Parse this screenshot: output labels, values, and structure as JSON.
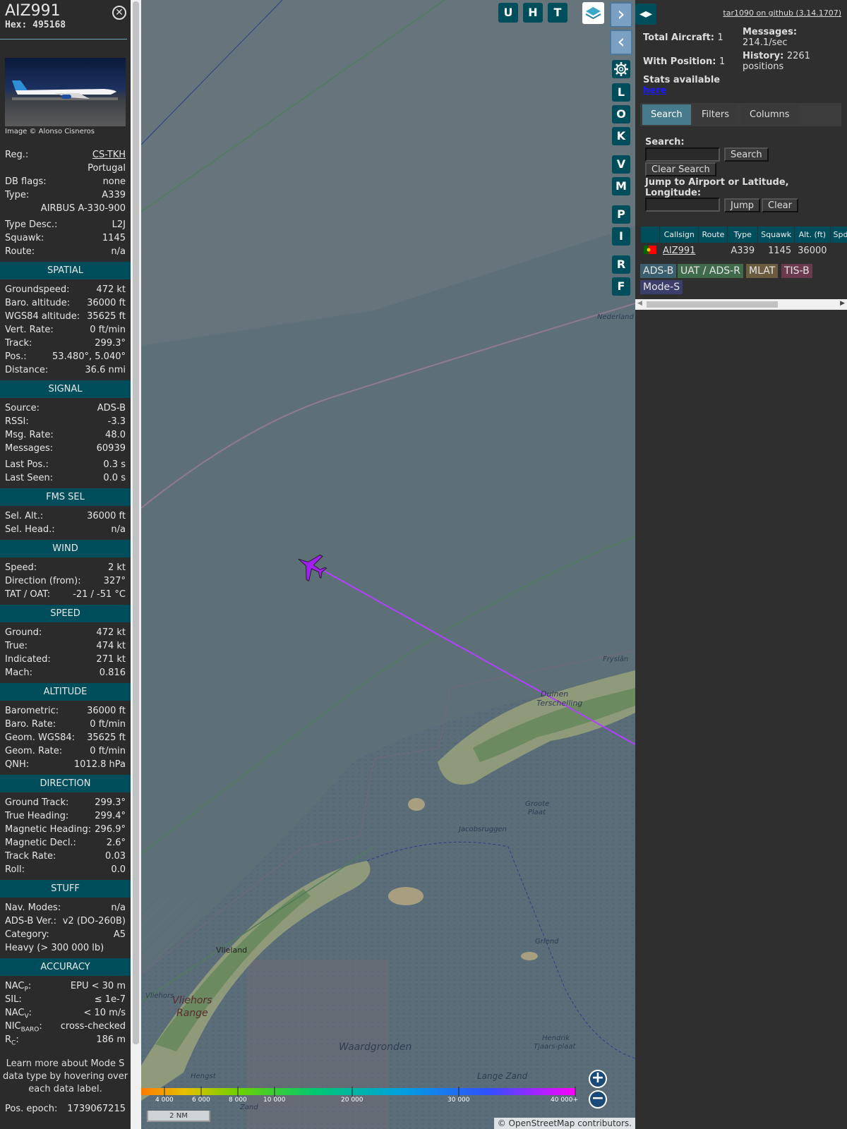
{
  "aircraft": {
    "callsign": "AIZ991",
    "hex_label": "Hex:",
    "hex": "495168",
    "photo_credit": "Image © Alonso Cisneros"
  },
  "details": [
    {
      "label": "Reg.:",
      "value": "CS-TKH",
      "link": true
    },
    {
      "label": "",
      "value": "Portugal"
    },
    {
      "label": "DB flags:",
      "value": "none"
    },
    {
      "label": "Type:",
      "value": "A339"
    },
    {
      "label": "",
      "value": "AIRBUS A-330-900"
    },
    {
      "label": "Type Desc.:",
      "value": "L2J"
    },
    {
      "label": "Squawk:",
      "value": "1145"
    },
    {
      "label": "Route:",
      "value": "n/a"
    }
  ],
  "sections": [
    {
      "title": "SPATIAL",
      "rows": [
        {
          "label": "Groundspeed:",
          "value": "472 kt"
        },
        {
          "label": "Baro. altitude:",
          "value": "36000 ft"
        },
        {
          "label": "WGS84 altitude:",
          "value": "35625 ft"
        },
        {
          "label": "Vert. Rate:",
          "value": "0 ft/min"
        },
        {
          "label": "Track:",
          "value": "299.3°"
        },
        {
          "label": "Pos.:",
          "value": "53.480°, 5.040°"
        },
        {
          "label": "Distance:",
          "value": "36.6 nmi"
        }
      ]
    },
    {
      "title": "SIGNAL",
      "rows": [
        {
          "label": "Source:",
          "value": "ADS-B"
        },
        {
          "label": "RSSI:",
          "value": "-3.3"
        },
        {
          "label": "Msg. Rate:",
          "value": "48.0"
        },
        {
          "label": "Messages:",
          "value": "60939"
        },
        {
          "label": "Last Pos.:",
          "value": "0.3 s"
        },
        {
          "label": "Last Seen:",
          "value": "0.0 s"
        }
      ]
    },
    {
      "title": "FMS SEL",
      "rows": [
        {
          "label": "Sel. Alt.:",
          "value": "36000 ft"
        },
        {
          "label": "Sel. Head.:",
          "value": "n/a"
        }
      ]
    },
    {
      "title": "WIND",
      "rows": [
        {
          "label": "Speed:",
          "value": "2 kt"
        },
        {
          "label": "Direction (from):",
          "value": "327°"
        },
        {
          "label": "TAT / OAT:",
          "value": "-21 / -51 °C"
        }
      ]
    },
    {
      "title": "SPEED",
      "rows": [
        {
          "label": "Ground:",
          "value": "472 kt"
        },
        {
          "label": "True:",
          "value": "474 kt"
        },
        {
          "label": "Indicated:",
          "value": "271 kt"
        },
        {
          "label": "Mach:",
          "value": "0.816"
        }
      ]
    },
    {
      "title": "ALTITUDE",
      "rows": [
        {
          "label": "Barometric:",
          "value": "36000 ft"
        },
        {
          "label": "Baro. Rate:",
          "value": "0 ft/min"
        },
        {
          "label": "Geom. WGS84:",
          "value": "35625 ft"
        },
        {
          "label": "Geom. Rate:",
          "value": "0 ft/min"
        },
        {
          "label": "QNH:",
          "value": "1012.8 hPa"
        }
      ]
    },
    {
      "title": "DIRECTION",
      "rows": [
        {
          "label": "Ground Track:",
          "value": "299.3°"
        },
        {
          "label": "True Heading:",
          "value": "299.4°"
        },
        {
          "label": "Magnetic Heading:",
          "value": "296.9°"
        },
        {
          "label": "Magnetic Decl.:",
          "value": "2.6°"
        },
        {
          "label": "Track Rate:",
          "value": "0.03"
        },
        {
          "label": "Roll:",
          "value": "0.0"
        }
      ]
    },
    {
      "title": "STUFF",
      "rows": [
        {
          "label": "Nav. Modes:",
          "value": "n/a"
        },
        {
          "label": "ADS-B Ver.:",
          "value": "v2 (DO-260B)"
        },
        {
          "label": "Category:",
          "value": "A5"
        },
        {
          "label": "Heavy (> 300 000 lb)",
          "value": ""
        }
      ]
    },
    {
      "title": "ACCURACY",
      "rows": [
        {
          "label": "NAC",
          "sub": "P",
          "value": "EPU < 30 m"
        },
        {
          "label": "SIL:",
          "value": "≤ 1e-7"
        },
        {
          "label": "NAC",
          "sub": "V",
          "value": "< 10 m/s"
        },
        {
          "label": "NIC",
          "sub": "BARO",
          "value": "cross-checked"
        },
        {
          "label": "R",
          "sub": "C",
          "value": "186 m"
        }
      ]
    }
  ],
  "learn_more": "Learn more about Mode S data type by hovering over each data label.",
  "pos_epoch": {
    "label": "Pos. epoch:",
    "value": "1739067215"
  },
  "map": {
    "top_buttons": [
      "U",
      "H",
      "T"
    ],
    "side_buttons": [
      "L",
      "O",
      "K",
      "V",
      "M",
      "P",
      "I",
      "R",
      "F"
    ],
    "place_labels": [
      "Nederland",
      "Fryslân",
      "Duinen",
      "Terschelling",
      "Groote",
      "Plaat",
      "Jacobsruggen",
      "Griend",
      "Vlieland",
      "Vliehors",
      "Vliehors",
      "Range",
      "Waardgronden",
      "Lange Zand",
      "Hendrik",
      "Tjaars-plaat",
      "Hengst",
      "Zand"
    ],
    "altitude_labels": [
      "4 000",
      "6 000",
      "8 000",
      "10 000",
      "20 000",
      "30 000",
      "40 000+"
    ],
    "scale": "2 NM",
    "attribution_prefix": "©",
    "attribution_link": "OpenStreetMap",
    "attribution_suffix": "contributors.",
    "zoom_in": "+",
    "zoom_out": "−"
  },
  "right": {
    "github_link": "tar1090 on github (3.14.1707)",
    "total_aircraft_label": "Total Aircraft:",
    "total_aircraft": "1",
    "with_position_label": "With Position:",
    "with_position": "1",
    "stats_text": "Stats available",
    "stats_link": "here",
    "messages_label": "Messages:",
    "messages_rate": "214.1/sec",
    "history_label": "History:",
    "history_value": "2261",
    "history_unit": "positions",
    "tabs": [
      "Search",
      "Filters",
      "Columns"
    ],
    "search_label": "Search:",
    "search_value": "",
    "search_button": "Search",
    "clear_search_button": "Clear Search",
    "jump_label": "Jump to Airport or Latitude, Longitude:",
    "jump_value": "",
    "jump_button": "Jump",
    "clear_button": "Clear",
    "table_headers": [
      "",
      "Callsign",
      "Route",
      "Type",
      "Squawk",
      "Alt. (ft)",
      "Spd."
    ],
    "table_rows": [
      {
        "flag": "PT",
        "callsign": "AIZ991",
        "route": "",
        "type": "A339",
        "squawk": "1145",
        "alt": "36000",
        "spd": ""
      }
    ],
    "badges": [
      {
        "label": "ADS-B",
        "color": "#3b5f6e"
      },
      {
        "label": "UAT / ADS-R",
        "color": "#3f6b4b"
      },
      {
        "label": "MLAT",
        "color": "#6b5b3f"
      },
      {
        "label": "TIS-B",
        "color": "#6b3a4f"
      },
      {
        "label": "Mode-S",
        "color": "#3c3f6b"
      }
    ]
  },
  "colors": {
    "accent": "#004d5c",
    "track": "#b040ff",
    "plane": "#a020f0"
  }
}
